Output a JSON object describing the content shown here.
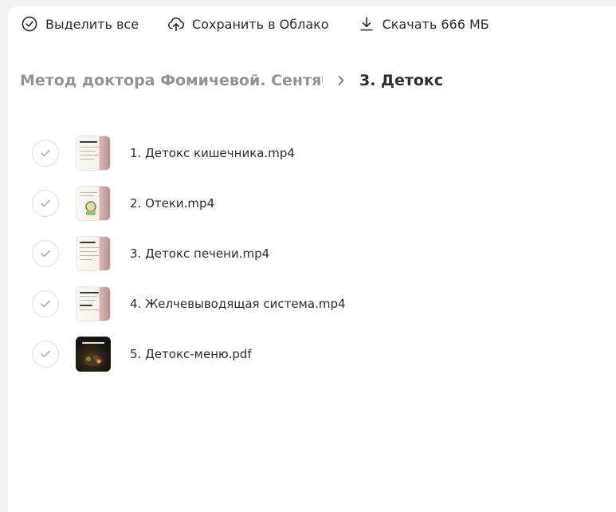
{
  "toolbar": {
    "select_all": "Выделить все",
    "save_cloud": "Сохранить в Облако",
    "download": "Скачать 666 МБ"
  },
  "breadcrumb": {
    "parent": "Метод доктора Фомичевой. Сентябр...",
    "current": "3. Детокс"
  },
  "files": [
    {
      "name": "1. Детокс кишечника.mp4",
      "thumb": "light"
    },
    {
      "name": "2. Отеки.mp4",
      "thumb": "light"
    },
    {
      "name": "3. Детокс печени.mp4",
      "thumb": "light"
    },
    {
      "name": "4. Желчевыводящая система.mp4",
      "thumb": "light"
    },
    {
      "name": "5. Детокс-меню.pdf",
      "thumb": "dark"
    }
  ],
  "colors": {
    "text": "#2c2d2e",
    "muted": "#919399",
    "border": "#dcdde0"
  }
}
